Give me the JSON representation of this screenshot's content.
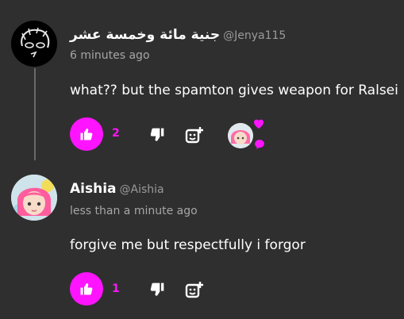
{
  "comments": [
    {
      "author": "جنية مائة وخمسة عشر",
      "handle": "@Jenya115",
      "time": "6 minutes ago",
      "text": "what?? but the spamton gives weapon for Ralsei",
      "likes": "2"
    },
    {
      "author": "Aishia",
      "handle": "@Aishia",
      "time": "less than a minute ago",
      "text": "forgive me but respectfully i forgor",
      "likes": "1"
    }
  ],
  "colors": {
    "accent": "#ff14ff",
    "background": "#2f2f2f",
    "muted_text": "#a6a6a6"
  },
  "icons": [
    "thumbs-up-icon",
    "thumbs-down-icon",
    "add-reaction-icon",
    "heart-icon",
    "chat-bubble-icon"
  ]
}
